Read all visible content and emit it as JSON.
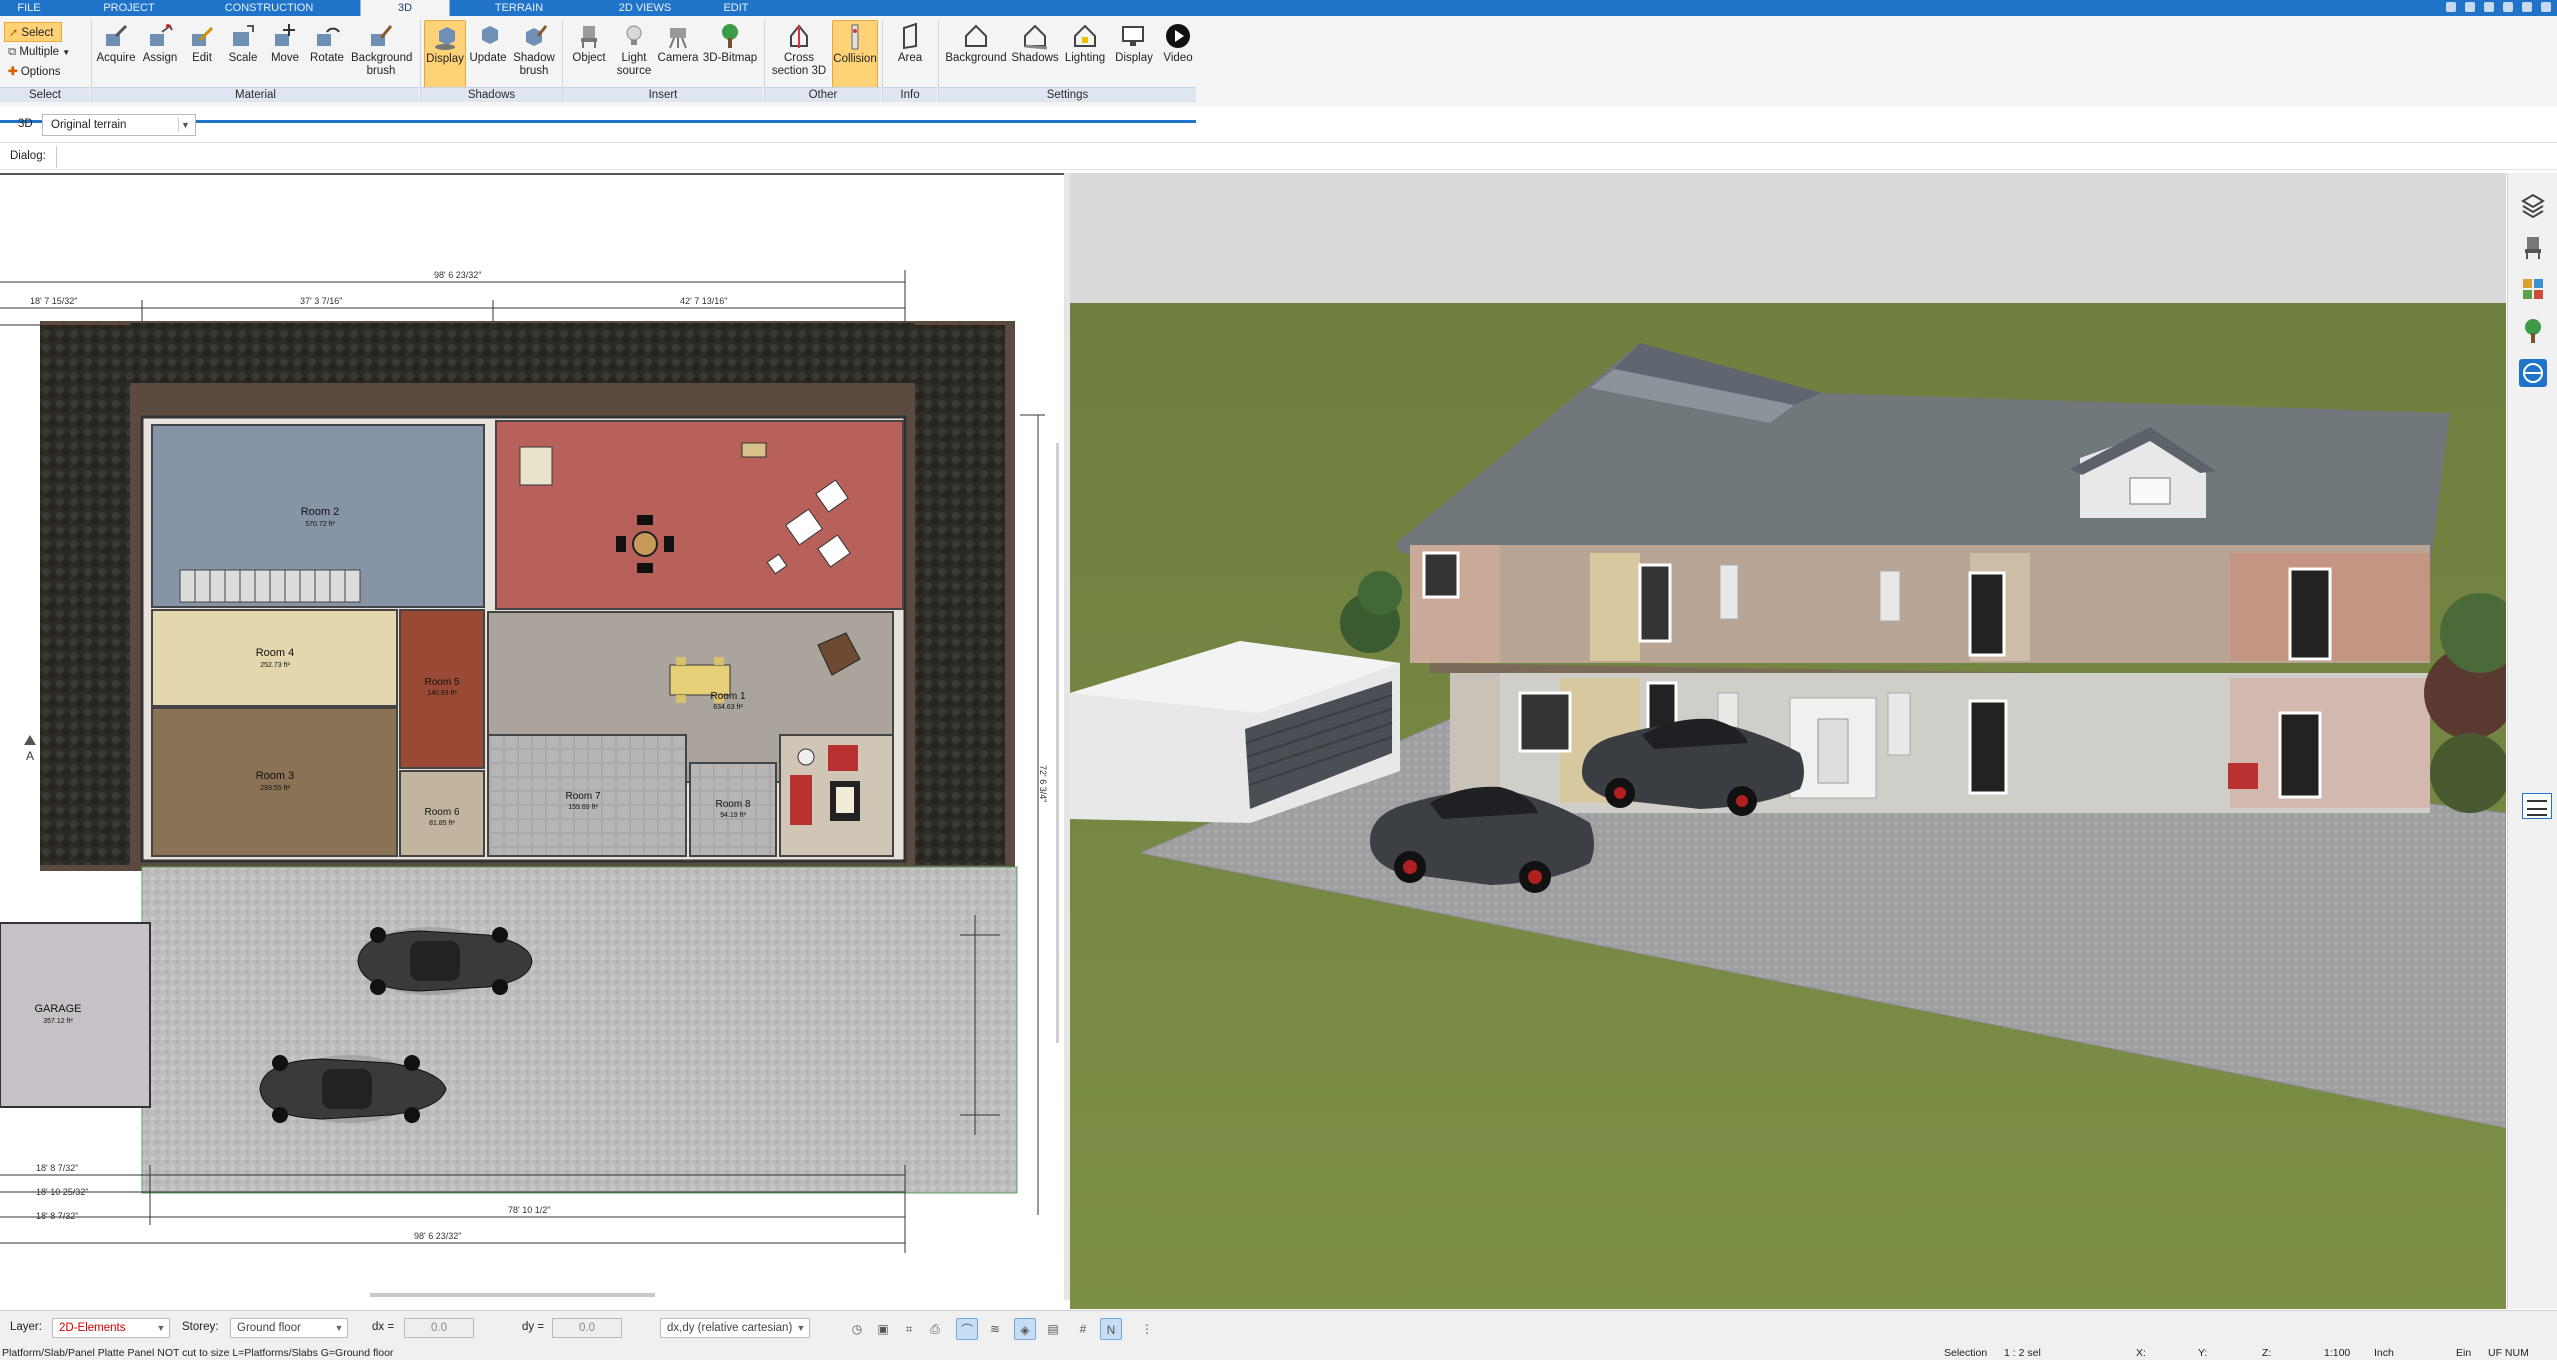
{
  "tabs": [
    {
      "label": "FILE",
      "active": false
    },
    {
      "label": "PROJECT",
      "active": false
    },
    {
      "label": "CONSTRUCTION",
      "active": false
    },
    {
      "label": "3D",
      "active": true
    },
    {
      "label": "TERRAIN",
      "active": false
    },
    {
      "label": "2D VIEWS",
      "active": false
    },
    {
      "label": "EDIT",
      "active": false
    }
  ],
  "select_group": {
    "select_label": "Select",
    "multiple_label": "Multiple",
    "options_label": "Options",
    "group_label": "Select"
  },
  "ribbon": {
    "material": {
      "group_label": "Material",
      "buttons": [
        "Acquire",
        "Assign",
        "Edit",
        "Scale",
        "Move",
        "Rotate",
        "Background brush"
      ]
    },
    "shadows": {
      "group_label": "Shadows",
      "buttons": [
        "Display",
        "Update",
        "Shadow brush"
      ]
    },
    "insert": {
      "group_label": "Insert",
      "buttons": [
        "Object",
        "Light source",
        "Camera",
        "3D-Bitmap"
      ]
    },
    "other": {
      "group_label": "Other",
      "buttons": [
        "Cross section 3D",
        "Collision"
      ]
    },
    "info": {
      "group_label": "Info",
      "buttons": [
        "Area"
      ]
    },
    "settings": {
      "group_label": "Settings",
      "buttons": [
        "Background",
        "Shadows",
        "Lighting",
        "Display",
        "Video"
      ]
    }
  },
  "terrain_row": {
    "label": "3D",
    "selected": "Original terrain"
  },
  "dialog_row": {
    "label": "Dialog:"
  },
  "plan": {
    "rooms": [
      {
        "name": "Room 2",
        "area": "570.72 ft²"
      },
      {
        "name": "Room 4",
        "area": "252.73 ft²"
      },
      {
        "name": "Room 3",
        "area": "293.55 ft²"
      },
      {
        "name": "Room 5",
        "area": "140.93 ft²"
      },
      {
        "name": "Room 1",
        "area": "634.63 ft²"
      },
      {
        "name": "Room 6",
        "area": "81.85 ft²"
      },
      {
        "name": "Room 7",
        "area": "159.69 ft²"
      },
      {
        "name": "Room 8",
        "area": "94.19 ft²"
      },
      {
        "name": "GARAGE",
        "area": "357.12 ft²"
      }
    ],
    "dimensions": {
      "top_total": "98' 6 23/32\"",
      "top_seg1": "18' 7 15/32\"",
      "top_seg2": "37' 3 7/16\"",
      "top_seg3": "42' 7 13/16\"",
      "bottom_total": "98' 6 23/32\"",
      "bottom_seg": "78' 10 1/2\"",
      "left_b1": "18' 8 7/32\"",
      "left_b2": "18' 10 25/32\"",
      "left_b3": "18' 8 7/32\"",
      "right_v": "72' 6 3/4\""
    },
    "north_arrow": "A"
  },
  "status": {
    "layer_label": "Layer:",
    "layer_value": "2D-Elements",
    "storey_label": "Storey:",
    "storey_value": "Ground floor",
    "dx_label": "dx =",
    "dx_value": "0.0",
    "dy_label": "dy =",
    "dy_value": "0.0",
    "coord_mode": "dx,dy (relative cartesian)",
    "hint": "Platform/Slab/Panel Platte Panel NOT cut to size L=Platforms/Slabs G=Ground floor",
    "selection_label": "Selection",
    "selection_value": "1 : 2 sel",
    "x_label": "X:",
    "y_label": "Y:",
    "z_label": "Z:",
    "scale": "1:100",
    "units": "Inch",
    "mode": "Ein",
    "keys": "UF NUM"
  },
  "colors": {
    "accent_blue": "#1f73c8",
    "active_yellow": "#ffd277",
    "layer_red": "#d40000"
  }
}
